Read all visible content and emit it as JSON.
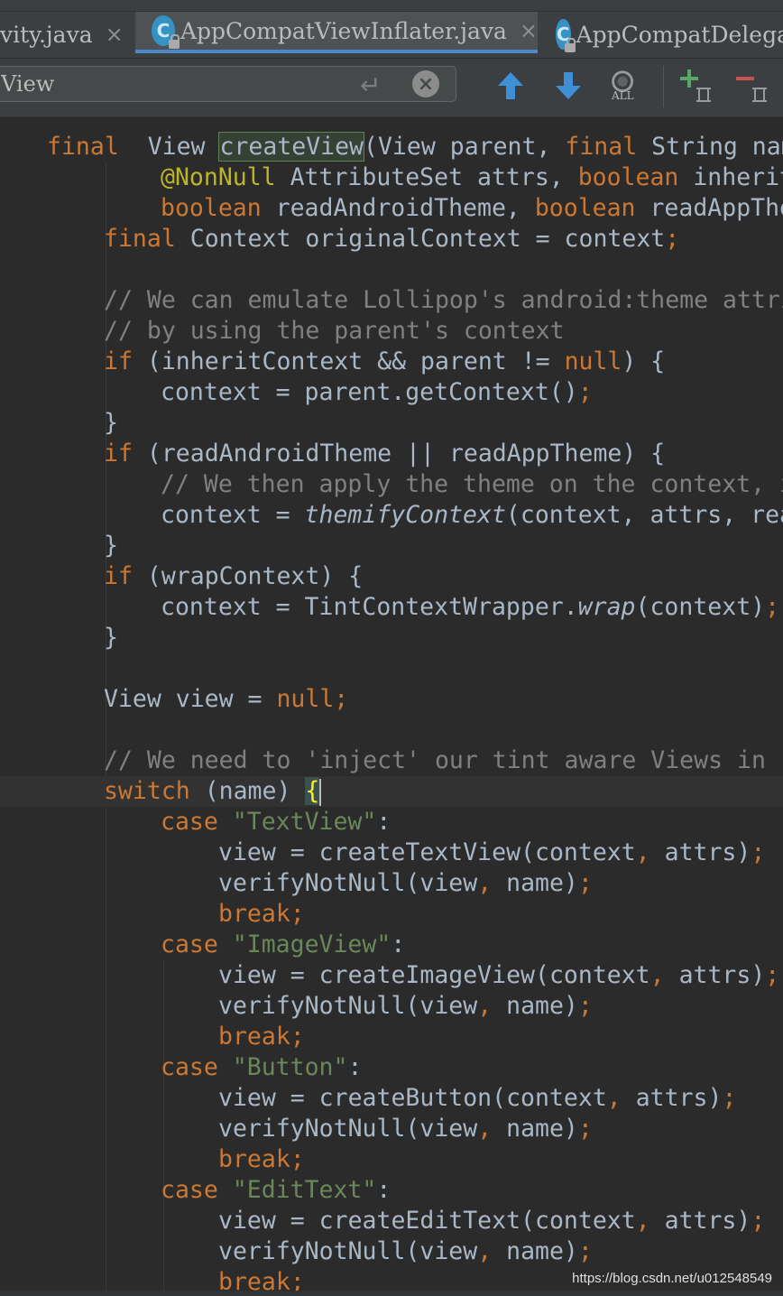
{
  "tabs": [
    {
      "label": "vity.java",
      "active": false,
      "has_icon": false
    },
    {
      "label": "AppCompatViewInflater.java",
      "active": true,
      "has_icon": true
    },
    {
      "label": "AppCompatDelega",
      "active": false,
      "has_icon": true
    }
  ],
  "tab_icon_letter": "C",
  "close_glyph": "×",
  "search": {
    "value": "View",
    "find_all_label": "ALL"
  },
  "icons": {
    "file": "class-file-icon",
    "enter": "enter-icon",
    "clear": "clear-icon",
    "prev": "arrow-up-icon",
    "next": "arrow-down-icon",
    "find_all": "find-all-icon",
    "add_selection": "add-selection-icon",
    "remove_selection": "remove-selection-icon"
  },
  "colors": {
    "keyword": "#cc7832",
    "annotation": "#bbb529",
    "string": "#6a8759",
    "comment": "#808080",
    "text": "#a9b7c6",
    "accent": "#4a88c7"
  },
  "code": {
    "lines": [
      {
        "indent": 1,
        "tokens": [
          [
            "kw",
            "final"
          ],
          [
            "",
            "  View "
          ],
          [
            "hl",
            "createView"
          ],
          [
            "",
            "(View parent, "
          ],
          [
            "kw",
            "final"
          ],
          [
            "",
            " String name"
          ]
        ]
      },
      {
        "indent": 3,
        "tokens": [
          [
            "ann",
            "@NonNull"
          ],
          [
            "",
            " AttributeSet attrs, "
          ],
          [
            "kw",
            "boolean"
          ],
          [
            "",
            " inherit"
          ]
        ]
      },
      {
        "indent": 3,
        "tokens": [
          [
            "kw",
            "boolean"
          ],
          [
            "",
            " readAndroidTheme, "
          ],
          [
            "kw",
            "boolean"
          ],
          [
            "",
            " readAppThe"
          ]
        ]
      },
      {
        "indent": 2,
        "tokens": [
          [
            "kw",
            "final"
          ],
          [
            "",
            " Context originalContext = context"
          ],
          [
            "kw",
            ";"
          ]
        ]
      },
      {
        "indent": 0,
        "tokens": []
      },
      {
        "indent": 2,
        "tokens": [
          [
            "cm",
            "// We can emulate Lollipop's android:theme attri"
          ]
        ]
      },
      {
        "indent": 2,
        "tokens": [
          [
            "cm",
            "// by using the parent's context"
          ]
        ]
      },
      {
        "indent": 2,
        "tokens": [
          [
            "kw",
            "if"
          ],
          [
            "",
            " (inheritContext && parent != "
          ],
          [
            "kw",
            "null"
          ],
          [
            "",
            ") {"
          ]
        ]
      },
      {
        "indent": 3,
        "tokens": [
          [
            "",
            "context = parent.getContext()"
          ],
          [
            "kw",
            ";"
          ]
        ]
      },
      {
        "indent": 2,
        "tokens": [
          [
            "",
            "}"
          ]
        ]
      },
      {
        "indent": 2,
        "tokens": [
          [
            "kw",
            "if"
          ],
          [
            "",
            " (readAndroidTheme || readAppTheme) {"
          ]
        ]
      },
      {
        "indent": 3,
        "tokens": [
          [
            "cm",
            "// We then apply the theme on the context, i"
          ]
        ]
      },
      {
        "indent": 3,
        "tokens": [
          [
            "",
            "context = "
          ],
          [
            "it",
            "themifyContext"
          ],
          [
            "",
            "(context, attrs, rea"
          ]
        ]
      },
      {
        "indent": 2,
        "tokens": [
          [
            "",
            "}"
          ]
        ]
      },
      {
        "indent": 2,
        "tokens": [
          [
            "kw",
            "if"
          ],
          [
            "",
            " (wrapContext) {"
          ]
        ]
      },
      {
        "indent": 3,
        "tokens": [
          [
            "",
            "context = TintContextWrapper."
          ],
          [
            "it",
            "wrap"
          ],
          [
            "",
            "(context)"
          ],
          [
            "kw",
            ";"
          ]
        ]
      },
      {
        "indent": 2,
        "tokens": [
          [
            "",
            "}"
          ]
        ]
      },
      {
        "indent": 0,
        "tokens": []
      },
      {
        "indent": 2,
        "tokens": [
          [
            "",
            "View view = "
          ],
          [
            "kw",
            "null;"
          ]
        ]
      },
      {
        "indent": 0,
        "tokens": []
      },
      {
        "indent": 2,
        "tokens": [
          [
            "cm",
            "// We need to 'inject' our tint aware Views in"
          ]
        ]
      },
      {
        "indent": 2,
        "current": true,
        "tokens": [
          [
            "kw",
            "switch"
          ],
          [
            "",
            " (name) "
          ],
          [
            "brace",
            "{"
          ]
        ]
      },
      {
        "indent": 3,
        "tokens": [
          [
            "kw",
            "case"
          ],
          [
            "",
            " "
          ],
          [
            "str",
            "\"TextView\""
          ],
          [
            "",
            ":"
          ]
        ]
      },
      {
        "indent": 4,
        "tokens": [
          [
            "",
            "view = createTextView(context"
          ],
          [
            "kw",
            ","
          ],
          [
            "",
            " attrs)"
          ],
          [
            "kw",
            ";"
          ]
        ]
      },
      {
        "indent": 4,
        "tokens": [
          [
            "",
            "verifyNotNull(view"
          ],
          [
            "kw",
            ","
          ],
          [
            "",
            " name)"
          ],
          [
            "kw",
            ";"
          ]
        ]
      },
      {
        "indent": 4,
        "tokens": [
          [
            "kw",
            "break;"
          ]
        ]
      },
      {
        "indent": 3,
        "tokens": [
          [
            "kw",
            "case"
          ],
          [
            "",
            " "
          ],
          [
            "str",
            "\"ImageView\""
          ],
          [
            "",
            ":"
          ]
        ]
      },
      {
        "indent": 4,
        "tokens": [
          [
            "",
            "view = createImageView(context"
          ],
          [
            "kw",
            ","
          ],
          [
            "",
            " attrs)"
          ],
          [
            "kw",
            ";"
          ]
        ]
      },
      {
        "indent": 4,
        "tokens": [
          [
            "",
            "verifyNotNull(view"
          ],
          [
            "kw",
            ","
          ],
          [
            "",
            " name)"
          ],
          [
            "kw",
            ";"
          ]
        ]
      },
      {
        "indent": 4,
        "tokens": [
          [
            "kw",
            "break;"
          ]
        ]
      },
      {
        "indent": 3,
        "tokens": [
          [
            "kw",
            "case"
          ],
          [
            "",
            " "
          ],
          [
            "str",
            "\"Button\""
          ],
          [
            "",
            ":"
          ]
        ]
      },
      {
        "indent": 4,
        "tokens": [
          [
            "",
            "view = createButton(context"
          ],
          [
            "kw",
            ","
          ],
          [
            "",
            " attrs)"
          ],
          [
            "kw",
            ";"
          ]
        ]
      },
      {
        "indent": 4,
        "tokens": [
          [
            "",
            "verifyNotNull(view"
          ],
          [
            "kw",
            ","
          ],
          [
            "",
            " name)"
          ],
          [
            "kw",
            ";"
          ]
        ]
      },
      {
        "indent": 4,
        "tokens": [
          [
            "kw",
            "break;"
          ]
        ]
      },
      {
        "indent": 3,
        "tokens": [
          [
            "kw",
            "case"
          ],
          [
            "",
            " "
          ],
          [
            "str",
            "\"EditText\""
          ],
          [
            "",
            ":"
          ]
        ]
      },
      {
        "indent": 4,
        "tokens": [
          [
            "",
            "view = createEditText(context"
          ],
          [
            "kw",
            ","
          ],
          [
            "",
            " attrs)"
          ],
          [
            "kw",
            ";"
          ]
        ]
      },
      {
        "indent": 4,
        "tokens": [
          [
            "",
            "verifyNotNull(view"
          ],
          [
            "kw",
            ","
          ],
          [
            "",
            " name)"
          ],
          [
            "kw",
            ";"
          ]
        ]
      },
      {
        "indent": 4,
        "tokens": [
          [
            "kw",
            "break;"
          ]
        ]
      }
    ]
  },
  "watermark": "https://blog.csdn.net/u012548549"
}
